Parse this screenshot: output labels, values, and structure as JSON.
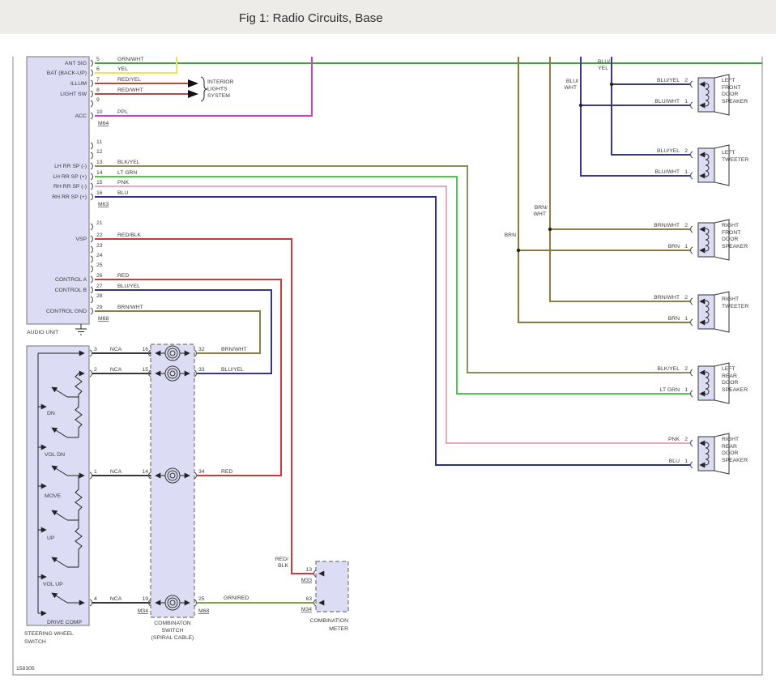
{
  "title": "Fig 1: Radio Circuits, Base",
  "diagram_id": "158305",
  "colors": {
    "title_bar_bg": "#edece9",
    "grn_wht": "#3da43d",
    "yel": "#ebe94e",
    "red_yel": "#a94f35",
    "red_wht": "#a95045",
    "ppl": "#ca3fc3",
    "blk_yel": "#8e8e5c",
    "lt_grn": "#49cb49",
    "pnk": "#e9a9ba",
    "blu": "#2c2c9c",
    "red_blk": "#c43b3b",
    "red": "#cc3a3a",
    "blu_yel": "#37377d",
    "blu_wht": "#3a3a96",
    "brn_wht": "#8e7e43",
    "brn": "#8a7a3c",
    "grn_red": "#7ba33c",
    "nca": "#1a1a1a"
  },
  "audio_unit": {
    "label": "AUDIO UNIT",
    "conn1": "M64",
    "conn2": "M63",
    "conn3": "M68",
    "pins": [
      {
        "n": "5",
        "sig": "ANT SIG",
        "wire": "GRN/WHT"
      },
      {
        "n": "6",
        "sig": "BAT (BACK-UP)",
        "wire": "YEL"
      },
      {
        "n": "7",
        "sig": "ILLUM",
        "wire": "RED/YEL"
      },
      {
        "n": "8",
        "sig": "LIGHT SW",
        "wire": "RED/WHT"
      },
      {
        "n": "9"
      },
      {
        "n": "10",
        "sig": "ACC",
        "wire": "PPL"
      },
      {
        "n": "11"
      },
      {
        "n": "12"
      },
      {
        "n": "13",
        "sig": "LH RR SP (-)",
        "wire": "BLK/YEL"
      },
      {
        "n": "14",
        "sig": "LH RR SP (+)",
        "wire": "LT GRN"
      },
      {
        "n": "15",
        "sig": "RH RR SP (-)",
        "wire": "PNK"
      },
      {
        "n": "16",
        "sig": "RH RR SP (+)",
        "wire": "BLU"
      },
      {
        "n": "21"
      },
      {
        "n": "22",
        "sig": "VSP",
        "wire": "RED/BLK"
      },
      {
        "n": "23"
      },
      {
        "n": "24"
      },
      {
        "n": "25"
      },
      {
        "n": "26",
        "sig": "CONTROL A",
        "wire": "RED"
      },
      {
        "n": "27",
        "sig": "CONTROL B",
        "wire": "BLU/YEL"
      },
      {
        "n": "28"
      },
      {
        "n": "29",
        "sig": "CONTROL GND",
        "wire": "BRN/WHT"
      }
    ]
  },
  "interior_lights": {
    "lines": [
      "INTERIOR",
      "LIGHTS",
      "SYSTEM"
    ]
  },
  "steering_wheel_switch": {
    "name": [
      "STEERING WHEEL",
      "SWITCH"
    ],
    "switches": [
      "DN",
      "VOL DN",
      "MOVE",
      "UP",
      "VOL UP",
      "DRIVE COMP"
    ]
  },
  "combination_switch": {
    "name": [
      "COMBINATON",
      "SWITCH",
      "(SPIRAL CABLE)"
    ],
    "rows": [
      {
        "lp": "3",
        "cable": "NCA",
        "mp": "16",
        "rp": "32",
        "out": "BRN/WHT"
      },
      {
        "lp": "2",
        "cable": "NCA",
        "mp": "15",
        "rp": "33",
        "out": "BLU/YEL"
      },
      {
        "lp": "1",
        "cable": "NCA",
        "mp": "14",
        "rp": "34",
        "out": "RED"
      },
      {
        "lp": "4",
        "cable": "NCA",
        "mp": "19",
        "rp": "25",
        "out": "GRN/RED",
        "lconn": "M34",
        "rconn": "M68"
      }
    ]
  },
  "combination_meter": {
    "name": [
      "COMBINATION",
      "METER"
    ],
    "pin_top": "13",
    "conn_top": "M33",
    "wire_top": [
      "RED/",
      "BLK"
    ],
    "pin_bot": "63",
    "conn_bot": "M34"
  },
  "trunks": {
    "blu_yel": [
      "BLU/",
      "YEL"
    ],
    "blu_wht": [
      "BLU/",
      "WHT"
    ],
    "brn_wht": [
      "BRN/",
      "WHT"
    ],
    "brn": [
      "BRN"
    ]
  },
  "speakers": [
    {
      "name": [
        "LEFT",
        "FRONT",
        "DOOR",
        "SPEAKER"
      ],
      "pin2": "2",
      "wire2": "BLU/YEL",
      "pin1": "1",
      "wire1": "BLU/WHT"
    },
    {
      "name": [
        "LEFT",
        "TWEETER"
      ],
      "pin2": "2",
      "wire2": "BLU/YEL",
      "pin1": "1",
      "wire1": "BLU/WHT"
    },
    {
      "name": [
        "RIGHT",
        "FRONT",
        "DOOR",
        "SPEAKER"
      ],
      "pin2": "2",
      "wire2": "BRN/WHT",
      "pin1": "1",
      "wire1": "BRN"
    },
    {
      "name": [
        "RIGHT",
        "TWEETER"
      ],
      "pin2": "2",
      "wire2": "BRN/WHT",
      "pin1": "1",
      "wire1": "BRN"
    },
    {
      "name": [
        "LEFT",
        "REAR",
        "DOOR",
        "SPEAKER"
      ],
      "pin2": "2",
      "wire2": "BLK/YEL",
      "pin1": "1",
      "wire1": "LT GRN"
    },
    {
      "name": [
        "RIGHT",
        "REAR",
        "DOOR",
        "SPEAKER"
      ],
      "pin2": "2",
      "wire2": "PNK",
      "pin1": "1",
      "wire1": "BLU"
    }
  ]
}
